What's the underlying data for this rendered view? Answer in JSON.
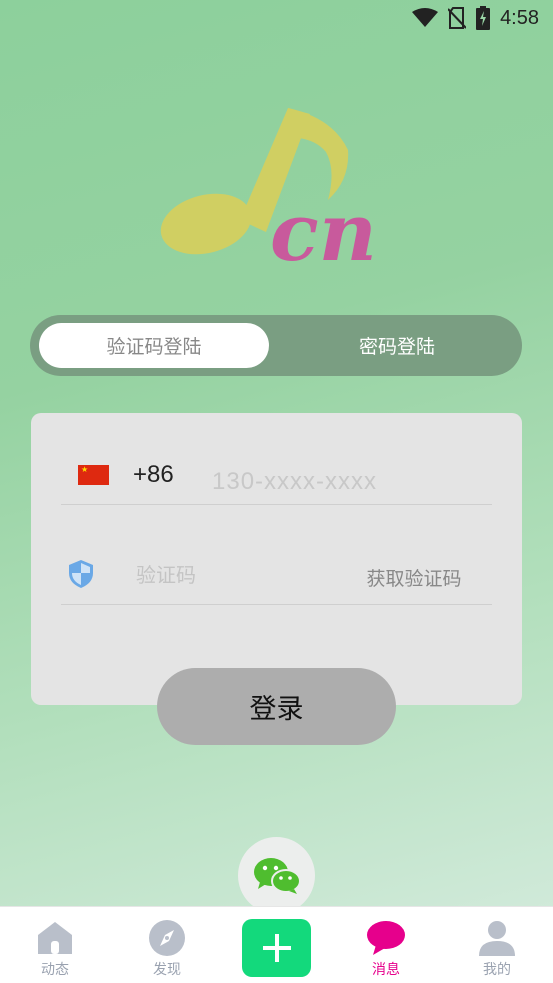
{
  "status_bar": {
    "time": "4:58",
    "icons": [
      "wifi-icon",
      "no-sim-icon",
      "battery-charging-icon"
    ]
  },
  "logo": {
    "text": "cn",
    "icon": "music-note-icon"
  },
  "login_tabs": [
    {
      "label": "验证码登陆",
      "active": true
    },
    {
      "label": "密码登陆",
      "active": false
    }
  ],
  "form": {
    "country_code": "+86",
    "phone_placeholder": "130-xxxx-xxxx",
    "sms_placeholder": "验证码",
    "get_code_label": "获取验证码"
  },
  "login_button": "登录",
  "social_login": {
    "icon": "wechat-icon"
  },
  "tab_bar": {
    "items": [
      {
        "label": "动态",
        "icon": "home-icon",
        "active": false
      },
      {
        "label": "发现",
        "icon": "compass-icon",
        "active": false
      },
      {
        "label": "",
        "icon": "plus-icon",
        "active": false
      },
      {
        "label": "消息",
        "icon": "message-bubble-icon",
        "active": true
      },
      {
        "label": "我的",
        "icon": "user-icon",
        "active": false
      }
    ]
  },
  "colors": {
    "accent_green": "#13d97c",
    "active_tab": "#e6008c",
    "logo_note": "#d0cf62",
    "logo_text": "#c85a9c"
  }
}
